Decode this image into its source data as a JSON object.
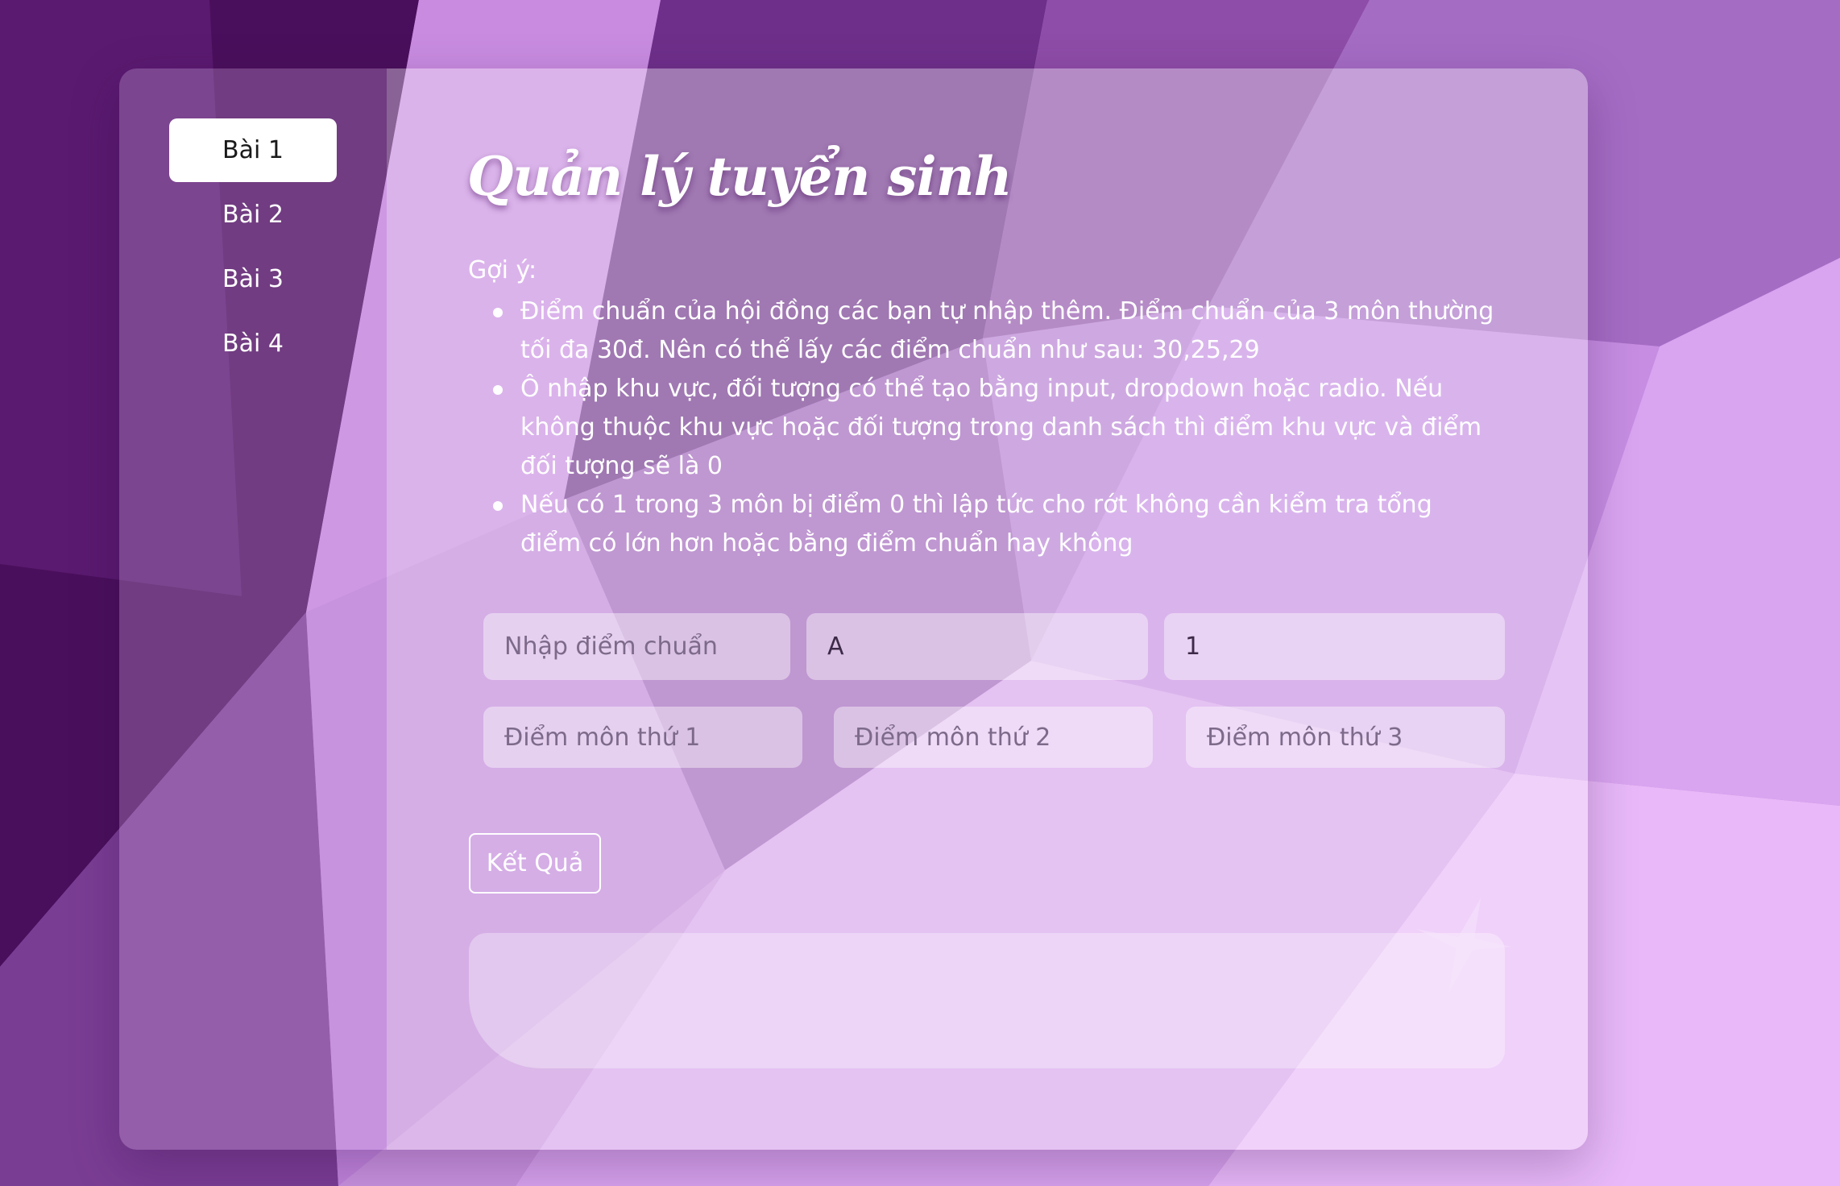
{
  "sidebar": {
    "items": [
      {
        "label": "Bài 1",
        "active": true
      },
      {
        "label": "Bài 2",
        "active": false
      },
      {
        "label": "Bài 3",
        "active": false
      },
      {
        "label": "Bài 4",
        "active": false
      }
    ]
  },
  "main": {
    "title": "Quản lý tuyển sinh",
    "hint_label": "Gợi ý:",
    "hints": [
      "Điểm chuẩn của hội đồng các bạn tự nhập thêm. Điểm chuẩn của 3 môn thường tối đa 30đ. Nên có thể lấy các điểm chuẩn như sau: 30,25,29",
      "Ô nhập khu vực, đối tượng có thể tạo bằng input, dropdown hoặc radio. Nếu không thuộc khu vực hoặc đối tượng trong danh sách thì điểm khu vực và điểm đối tượng sẽ là 0",
      "Nếu có 1 trong 3 môn bị điểm 0 thì lập tức cho rớt không cần kiểm tra tổng điểm có lớn hơn hoặc bằng điểm chuẩn hay không"
    ],
    "inputs": {
      "benchmark": {
        "placeholder": "Nhập điểm chuẩn",
        "value": ""
      },
      "region": {
        "placeholder": "",
        "value": "A"
      },
      "subject_group": {
        "placeholder": "",
        "value": "1"
      },
      "score1": {
        "placeholder": "Điểm môn thứ 1",
        "value": ""
      },
      "score2": {
        "placeholder": "Điểm môn thứ 2",
        "value": ""
      },
      "score3": {
        "placeholder": "Điểm môn thứ 3",
        "value": ""
      }
    },
    "result_button": "Kết Quả",
    "result_text": ""
  },
  "icons": {
    "decor": "sparkle-star-icon"
  },
  "colors": {
    "background": "#a86ecb",
    "active_nav_bg": "#ffffff",
    "text": "#ffffff"
  }
}
